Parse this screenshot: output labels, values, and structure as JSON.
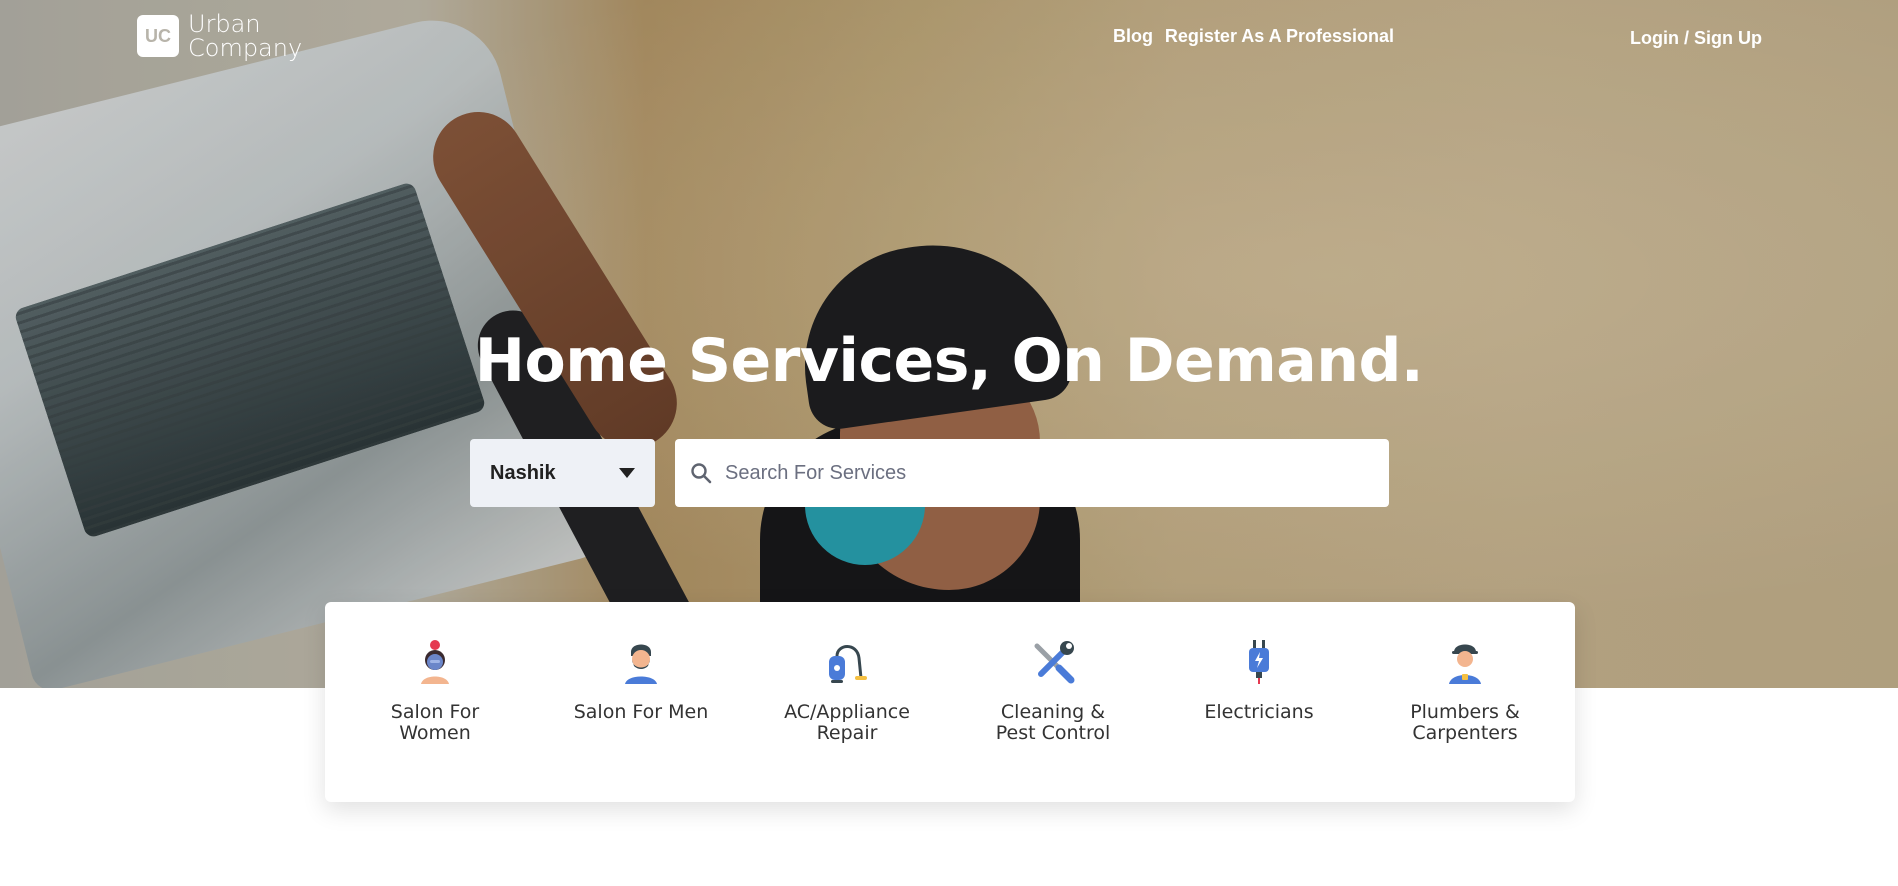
{
  "brand": {
    "logo_mark": "UC",
    "name_line1": "Urban",
    "name_line2": "Company"
  },
  "nav": {
    "blog": "Blog",
    "register": "Register As A Professional",
    "login": "Login / Sign Up"
  },
  "hero": {
    "headline": "Home Services, On Demand."
  },
  "city": {
    "selected": "Nashik",
    "icon": "chevron-down-icon"
  },
  "search": {
    "placeholder": "Search For Services",
    "value": "",
    "icon": "search-icon"
  },
  "services": [
    {
      "label_line1": "Salon For",
      "label_line2": "Women",
      "icon": "salon-women-icon"
    },
    {
      "label_line1": "Salon For Men",
      "label_line2": "",
      "icon": "salon-men-icon"
    },
    {
      "label_line1": "AC/Appliance",
      "label_line2": "Repair",
      "icon": "vacuum-icon"
    },
    {
      "label_line1": "Cleaning &",
      "label_line2": "Pest Control",
      "icon": "tools-icon"
    },
    {
      "label_line1": "Electricians",
      "label_line2": "",
      "icon": "plug-icon"
    },
    {
      "label_line1": "Plumbers &",
      "label_line2": "Carpenters",
      "icon": "plumber-icon"
    }
  ],
  "colors": {
    "icon_blue": "#4a7bd8",
    "icon_dark": "#37474f",
    "accent_red": "#e53950",
    "skin": "#f3b58f"
  }
}
